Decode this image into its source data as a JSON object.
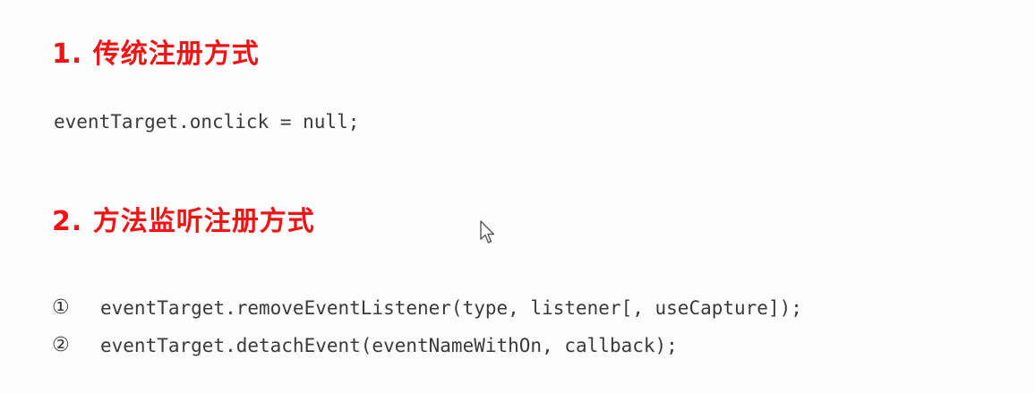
{
  "section1": {
    "heading": "1. 传统注册方式",
    "code": "eventTarget.onclick = null;"
  },
  "section2": {
    "heading": "2. 方法监听注册方式",
    "items": [
      {
        "marker": "①",
        "code": "eventTarget.removeEventListener(type, listener[, useCapture]);"
      },
      {
        "marker": "②",
        "code": "eventTarget.detachEvent(eventNameWithOn, callback);"
      }
    ]
  },
  "cursor": {
    "icon": "mouse-pointer-icon"
  }
}
